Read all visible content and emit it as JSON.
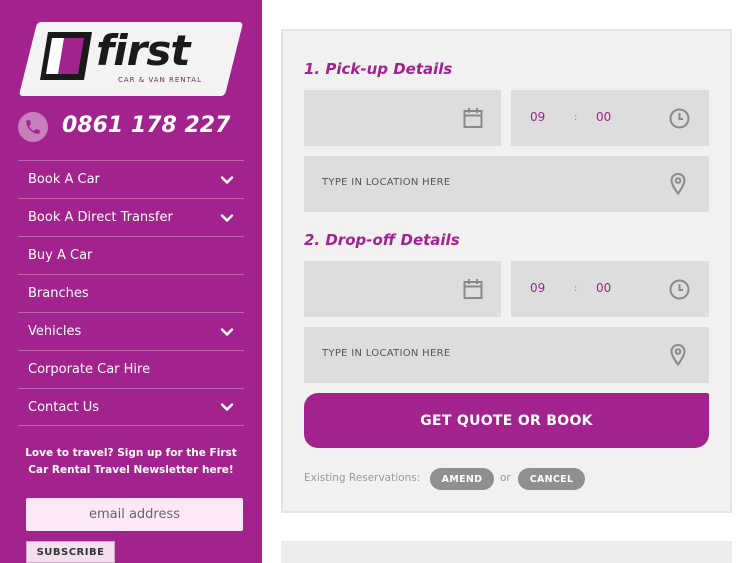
{
  "brand": {
    "logo_word": "first",
    "logo_tagline": "CAR & VAN RENTAL",
    "accent_color": "#a3238e"
  },
  "contact": {
    "phone": "0861 178 227",
    "phone_icon": "phone-icon"
  },
  "nav": {
    "items": [
      {
        "label": "Book A Car",
        "has_submenu": true
      },
      {
        "label": "Book A Direct Transfer",
        "has_submenu": true
      },
      {
        "label": "Buy A Car",
        "has_submenu": false
      },
      {
        "label": "Branches",
        "has_submenu": false
      },
      {
        "label": "Vehicles",
        "has_submenu": true
      },
      {
        "label": "Corporate Car Hire",
        "has_submenu": false
      },
      {
        "label": "Contact Us",
        "has_submenu": true
      }
    ]
  },
  "newsletter": {
    "text": "Love to travel? Sign up for the First Car Rental Travel Newsletter here!",
    "email_placeholder": "email address",
    "subscribe_label": "SUBSCRIBE"
  },
  "booking": {
    "pickup": {
      "title": "1. Pick-up Details",
      "hour": "09",
      "minute": "00",
      "separator": ":",
      "location_placeholder": "TYPE IN LOCATION HERE"
    },
    "dropoff": {
      "title": "2. Drop-off Details",
      "hour": "09",
      "minute": "00",
      "separator": ":",
      "location_placeholder": "TYPE IN LOCATION HERE"
    },
    "submit_label": "GET QUOTE OR BOOK",
    "existing_label": "Existing Reservations:",
    "amend_label": "AMEND",
    "or_label": "or",
    "cancel_label": "CANCEL"
  }
}
